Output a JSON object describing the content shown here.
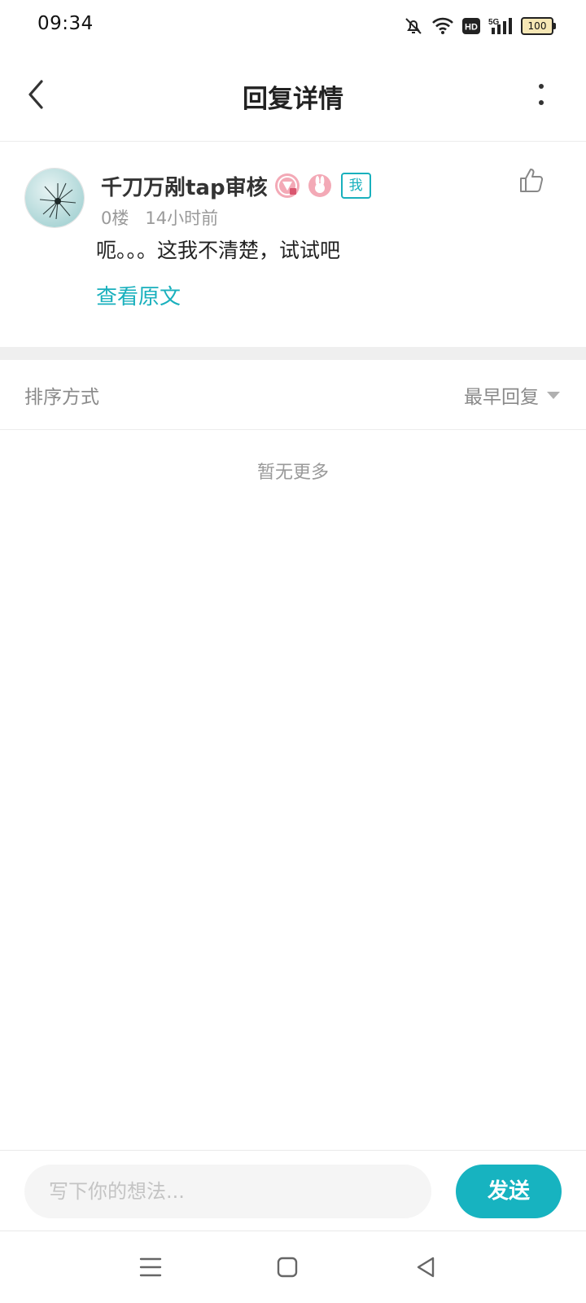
{
  "status_bar": {
    "time": "09:34",
    "battery": "100",
    "network": "5G",
    "hd": "HD"
  },
  "header": {
    "title": "回复详情"
  },
  "comment": {
    "username": "千刀万剐tap审核",
    "me_tag": "我",
    "floor": "0楼",
    "time_ago": "14小时前",
    "text": "呃。。。这我不清楚，试试吧",
    "view_original": "查看原文"
  },
  "sort": {
    "label": "排序方式",
    "selected": "最早回复"
  },
  "empty_text": "暂无更多",
  "reply_bar": {
    "placeholder": "写下你的想法...",
    "send_label": "发送"
  },
  "colors": {
    "accent": "#17b3c0",
    "badge_pink": "#f08aa0"
  },
  "icons": {
    "back": "back-arrow-icon",
    "more": "more-vertical-icon",
    "like": "thumbs-up-icon",
    "sort_caret": "caret-down-icon",
    "nav_menu": "menu-icon",
    "nav_home": "home-square-icon",
    "nav_back": "back-triangle-icon"
  }
}
